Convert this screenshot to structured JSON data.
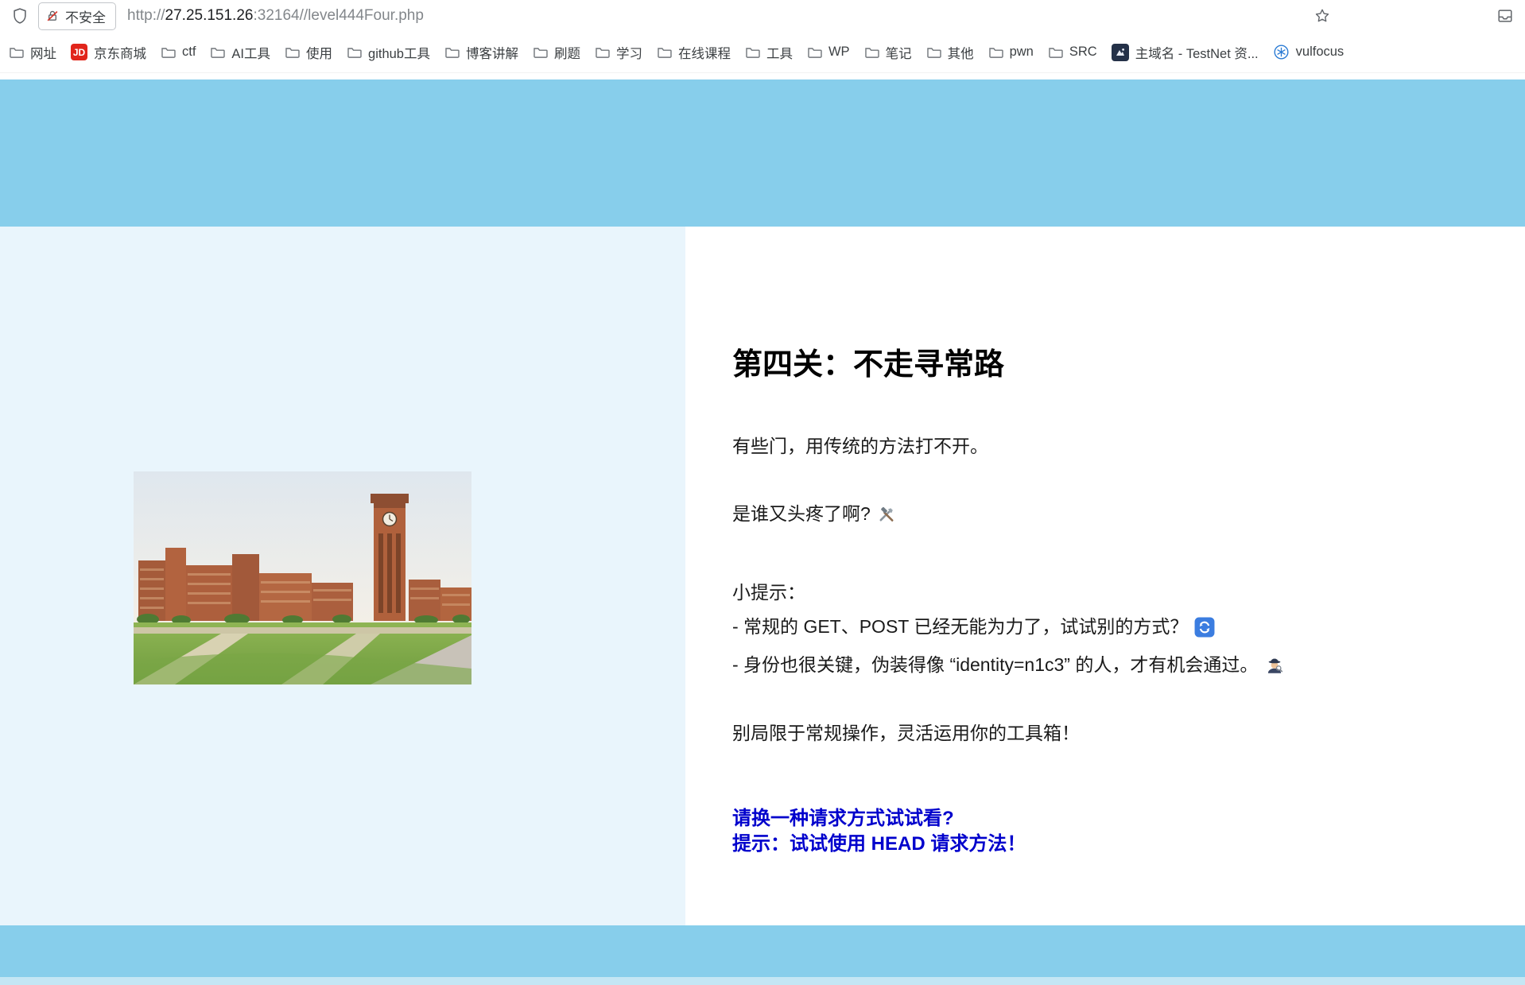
{
  "browser": {
    "security_chip": {
      "label": "不安全"
    },
    "url": {
      "scheme": "http://",
      "host": "27.25.151.26",
      "rest": ":32164//level444Four.php",
      "full": "http://27.25.151.26:32164//level444Four.php"
    },
    "bookmarks": [
      {
        "label": "网址",
        "icon": "folder"
      },
      {
        "label": "京东商城",
        "icon": "jd",
        "badge": "JD"
      },
      {
        "label": "ctf",
        "icon": "folder"
      },
      {
        "label": "AI工具",
        "icon": "folder"
      },
      {
        "label": "使用",
        "icon": "folder"
      },
      {
        "label": "github工具",
        "icon": "folder"
      },
      {
        "label": "博客讲解",
        "icon": "folder"
      },
      {
        "label": "刷题",
        "icon": "folder"
      },
      {
        "label": "学习",
        "icon": "folder"
      },
      {
        "label": "在线课程",
        "icon": "folder"
      },
      {
        "label": "工具",
        "icon": "folder"
      },
      {
        "label": "WP",
        "icon": "folder"
      },
      {
        "label": "笔记",
        "icon": "folder"
      },
      {
        "label": "其他",
        "icon": "folder"
      },
      {
        "label": "pwn",
        "icon": "folder"
      },
      {
        "label": "SRC",
        "icon": "folder"
      },
      {
        "label": "主域名 - TestNet 资...",
        "icon": "testnet"
      },
      {
        "label": "vulfocus",
        "icon": "vulfocus"
      }
    ]
  },
  "page": {
    "heading": "第四关：不走寻常路",
    "p1": "有些门，用传统的方法打不开。",
    "p2": "是谁又头疼了啊?",
    "hints": {
      "label": "小提示：",
      "line1": "- 常规的 GET、POST 已经无能为力了，试试别的方式？",
      "line2": "- 身份也很关键，伪装得像 “identity=n1c3” 的人，才有机会通过。"
    },
    "p3": "别局限于常规操作，灵活运用你的工具箱！",
    "cta": {
      "line1": "请换一种请求方式试试看?",
      "line2": "提示：试试使用 HEAD 请求方法！"
    },
    "emojis": {
      "p2_suffix": "hammer-and-wrench",
      "hint1_suffix": "counterclockwise-arrows-button",
      "hint2_suffix": "detective"
    }
  },
  "colors": {
    "header_band": "#87ceeb",
    "left_panel": "#e9f5fc",
    "cta_text": "#0000cc",
    "jd_red": "#e1251b"
  }
}
